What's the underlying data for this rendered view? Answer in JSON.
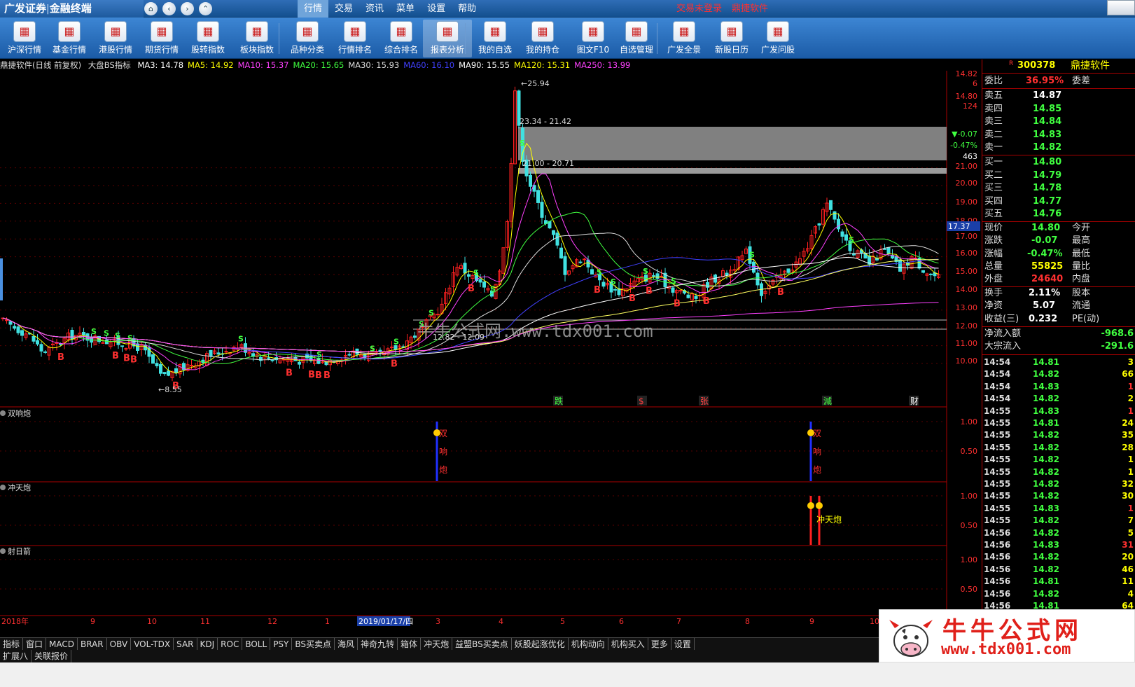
{
  "topbar": {
    "brand": "广发证券",
    "brand_sub": "金融终端",
    "menu": [
      "行情",
      "交易",
      "资讯",
      "菜单",
      "设置",
      "帮助"
    ],
    "trade_status": "交易未登录",
    "software": "鼎捷软件"
  },
  "toolbar": [
    "沪深行情",
    "基金行情",
    "港股行情",
    "期货行情",
    "股转指数",
    "板块指数",
    "品种分类",
    "行情排名",
    "综合排名",
    "报表分析",
    "我的自选",
    "我的持仓",
    "图文F10",
    "自选管理",
    "广发全景",
    "新股日历",
    "广发问股"
  ],
  "info_line": {
    "title": "鼎捷软件(日线 前复权)",
    "indicator": "大盘BS指标",
    "ma": [
      {
        "label": "MA3: 14.78",
        "color": "#ffffff"
      },
      {
        "label": "MA5: 14.92",
        "color": "#ffff00"
      },
      {
        "label": "MA10: 15.37",
        "color": "#ff40ff"
      },
      {
        "label": "MA20: 15.65",
        "color": "#40ff40"
      },
      {
        "label": "MA30: 15.93",
        "color": "#dddddd"
      },
      {
        "label": "MA60: 16.10",
        "color": "#4040ff"
      },
      {
        "label": "MA90: 15.55",
        "color": "#ffffff"
      },
      {
        "label": "MA120: 15.31",
        "color": "#ffff00"
      },
      {
        "label": "MA250: 13.99",
        "color": "#ff40ff"
      }
    ]
  },
  "chart": {
    "price_axis": [
      "14.82",
      "6",
      "14.80",
      "124",
      "▼-0.07",
      "-0.47%",
      "463",
      "21.00",
      "20.00",
      "19.00",
      "18.00",
      "17.00",
      "16.00",
      "15.00",
      "14.00",
      "13.00",
      "12.00",
      "11.00",
      "10.00"
    ],
    "current_price_tag": "17.37",
    "annotations": {
      "high": "25.94",
      "zone1": "23.34 - 21.42",
      "zone2": "21.00 - 20.71",
      "low": "8.55",
      "mid_label": "12.82 - 12.09"
    },
    "event_marks": [
      "跌",
      "$",
      "张",
      "減",
      "财"
    ],
    "panels": [
      {
        "name": "双响炮",
        "axis": [
          "1.00",
          "0.50"
        ],
        "labels": [
          "双",
          "响",
          "炮"
        ]
      },
      {
        "name": "冲天炮",
        "axis": [
          "1.00",
          "0.50"
        ],
        "labels": [
          "冲天炮"
        ]
      },
      {
        "name": "射日箭",
        "axis": [
          "1.00",
          "0.50"
        ]
      }
    ],
    "date_axis": [
      "2018年",
      "9",
      "10",
      "11",
      "12",
      "1",
      "2019/01/17/四",
      "3",
      "4",
      "5",
      "6",
      "7",
      "8",
      "9",
      "10"
    ],
    "watermark_text": "牛牛公式网.www.tdx001.com"
  },
  "tabs_row1": [
    "指标",
    "窗口",
    "MACD",
    "BRAR",
    "OBV",
    "VOL-TDX",
    "SAR",
    "KDJ",
    "ROC",
    "BOLL",
    "PSY",
    "BS买卖点",
    "海风",
    "神奇九转",
    "箱体",
    "冲天炮",
    "益盟BS买卖点",
    "妖股起涨优化",
    "机构动向",
    "机构买入",
    "更多",
    "设置"
  ],
  "tabs_row2": [
    "扩展八",
    "关联报价"
  ],
  "quote": {
    "code": "300378",
    "name": "鼎捷软件",
    "webi_label": "委比",
    "webi": "36.95%",
    "weicha_label": "委差",
    "sells": [
      {
        "label": "卖五",
        "price": "14.87"
      },
      {
        "label": "卖四",
        "price": "14.85"
      },
      {
        "label": "卖三",
        "price": "14.84"
      },
      {
        "label": "卖二",
        "price": "14.83"
      },
      {
        "label": "卖一",
        "price": "14.82"
      }
    ],
    "buys": [
      {
        "label": "买一",
        "price": "14.80"
      },
      {
        "label": "买二",
        "price": "14.79"
      },
      {
        "label": "买三",
        "price": "14.78"
      },
      {
        "label": "买四",
        "price": "14.77"
      },
      {
        "label": "买五",
        "price": "14.76"
      }
    ],
    "stats": [
      {
        "l": "现价",
        "v": "14.80",
        "r": "今开",
        "c": "#40ff40"
      },
      {
        "l": "涨跌",
        "v": "-0.07",
        "r": "最高",
        "c": "#40ff40"
      },
      {
        "l": "涨幅",
        "v": "-0.47%",
        "r": "最低",
        "c": "#40ff40"
      },
      {
        "l": "总量",
        "v": "55825",
        "r": "量比",
        "c": "#ffff00"
      },
      {
        "l": "外盘",
        "v": "24640",
        "r": "内盘",
        "c": "#ff3030"
      }
    ],
    "stats2": [
      {
        "l": "换手",
        "v": "2.11%",
        "r": "股本"
      },
      {
        "l": "净资",
        "v": "5.07",
        "r": "流通"
      },
      {
        "l": "收益(三)",
        "v": "0.232",
        "r": "PE(动)"
      }
    ],
    "flow": [
      {
        "l": "净流入额",
        "v": "-968.6"
      },
      {
        "l": "大宗流入",
        "v": "-291.6"
      }
    ],
    "ticks": [
      {
        "t": "14:54",
        "p": "14.81",
        "v": "3",
        "pc": "#40ff40",
        "vc": "#ffff00"
      },
      {
        "t": "14:54",
        "p": "14.82",
        "v": "66",
        "pc": "#40ff40",
        "vc": "#ffff00"
      },
      {
        "t": "14:54",
        "p": "14.83",
        "v": "1",
        "pc": "#40ff40",
        "vc": "#ff3030"
      },
      {
        "t": "14:54",
        "p": "14.82",
        "v": "2",
        "pc": "#40ff40",
        "vc": "#ffff00"
      },
      {
        "t": "14:55",
        "p": "14.83",
        "v": "1",
        "pc": "#40ff40",
        "vc": "#ff3030"
      },
      {
        "t": "14:55",
        "p": "14.81",
        "v": "24",
        "pc": "#40ff40",
        "vc": "#ffff00"
      },
      {
        "t": "14:55",
        "p": "14.82",
        "v": "35",
        "pc": "#40ff40",
        "vc": "#ffff00"
      },
      {
        "t": "14:55",
        "p": "14.82",
        "v": "28",
        "pc": "#40ff40",
        "vc": "#ffff00"
      },
      {
        "t": "14:55",
        "p": "14.82",
        "v": "1",
        "pc": "#40ff40",
        "vc": "#ffff00"
      },
      {
        "t": "14:55",
        "p": "14.82",
        "v": "1",
        "pc": "#40ff40",
        "vc": "#ffff00"
      },
      {
        "t": "14:55",
        "p": "14.82",
        "v": "32",
        "pc": "#40ff40",
        "vc": "#ffff00"
      },
      {
        "t": "14:55",
        "p": "14.82",
        "v": "30",
        "pc": "#40ff40",
        "vc": "#ffff00"
      },
      {
        "t": "14:55",
        "p": "14.83",
        "v": "1",
        "pc": "#40ff40",
        "vc": "#ff3030"
      },
      {
        "t": "14:55",
        "p": "14.82",
        "v": "7",
        "pc": "#40ff40",
        "vc": "#ffff00"
      },
      {
        "t": "14:56",
        "p": "14.82",
        "v": "5",
        "pc": "#40ff40",
        "vc": "#ffff00"
      },
      {
        "t": "14:56",
        "p": "14.83",
        "v": "31",
        "pc": "#40ff40",
        "vc": "#ff3030"
      },
      {
        "t": "14:56",
        "p": "14.82",
        "v": "20",
        "pc": "#40ff40",
        "vc": "#ffff00"
      },
      {
        "t": "14:56",
        "p": "14.82",
        "v": "46",
        "pc": "#40ff40",
        "vc": "#ffff00"
      },
      {
        "t": "14:56",
        "p": "14.81",
        "v": "11",
        "pc": "#40ff40",
        "vc": "#ffff00"
      },
      {
        "t": "14:56",
        "p": "14.82",
        "v": "4",
        "pc": "#40ff40",
        "vc": "#ffff00"
      },
      {
        "t": "14:56",
        "p": "14.81",
        "v": "64",
        "pc": "#40ff40",
        "vc": "#ffff00"
      }
    ]
  },
  "watermark": {
    "title": "牛牛公式网",
    "url": "www.tdx001.com"
  }
}
